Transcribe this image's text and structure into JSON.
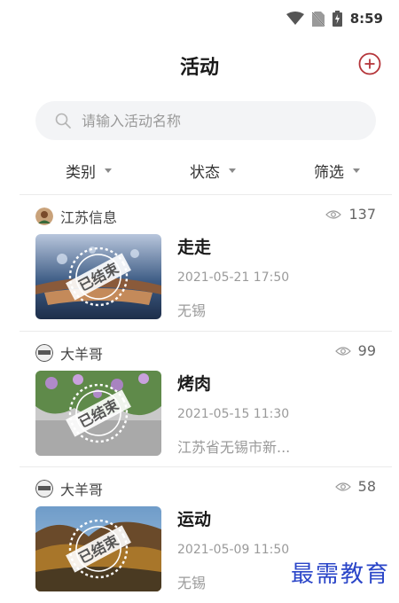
{
  "status_bar": {
    "time": "8:59"
  },
  "header": {
    "title": "活动"
  },
  "search": {
    "placeholder": "请输入活动名称"
  },
  "filters": [
    "类别",
    "状态",
    "筛选"
  ],
  "stamp_text": "已结束",
  "activities": [
    {
      "author": "江苏信息",
      "views": "137",
      "title": "走走",
      "datetime": "2021-05-21 17:50",
      "location": "无锡"
    },
    {
      "author": "大羊哥",
      "views": "99",
      "title": "烤肉",
      "datetime": "2021-05-15 11:30",
      "location": "江苏省无锡市新..."
    },
    {
      "author": "大羊哥",
      "views": "58",
      "title": "运动",
      "datetime": "2021-05-09 11:50",
      "location": "无锡"
    }
  ],
  "watermark": "最需教育",
  "colors": {
    "accent_red": "#b5353a",
    "watermark_blue": "#2a45c8"
  }
}
